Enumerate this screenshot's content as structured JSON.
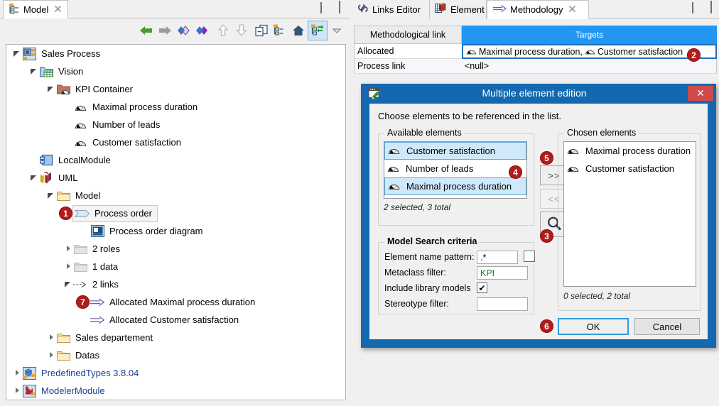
{
  "left_panel": {
    "tab": {
      "label": "Model",
      "close": "✕",
      "icon": "model-tree-icon"
    },
    "window_controls": {
      "minimize": "minimize-icon",
      "maximize": "maximize-icon"
    },
    "toolbar": {
      "items": [
        {
          "name": "back-arrow-icon",
          "title": "Back"
        },
        {
          "name": "forward-arrow-icon",
          "title": "Forward"
        },
        {
          "name": "previous-element-icon",
          "title": "Previous"
        },
        {
          "name": "next-element-icon",
          "title": "Next"
        },
        {
          "name": "up-arrow-icon",
          "title": "Up"
        },
        {
          "name": "down-arrow-icon",
          "title": "Down"
        },
        {
          "name": "collapse-all-icon",
          "title": "Collapse all"
        },
        {
          "name": "expand-tree-icon",
          "title": "Expand"
        },
        {
          "name": "home-icon",
          "title": "Home"
        },
        {
          "name": "link-with-editor-icon",
          "title": "Link with editor"
        },
        {
          "name": "view-menu-icon",
          "title": "View menu"
        }
      ]
    },
    "tree": [
      {
        "label": "Sales Process",
        "indent": 0,
        "twist": "open",
        "icon": "model-project-icon",
        "selected": false
      },
      {
        "label": "Vision",
        "indent": 1,
        "twist": "open",
        "icon": "vision-folder-icon",
        "selected": false
      },
      {
        "label": "KPI Container",
        "indent": 2,
        "twist": "open",
        "icon": "kpi-container-icon",
        "selected": false
      },
      {
        "label": "Maximal process duration",
        "indent": 3,
        "twist": "none",
        "icon": "kpi-gauge-icon",
        "selected": false
      },
      {
        "label": "Number of leads",
        "indent": 3,
        "twist": "none",
        "icon": "kpi-gauge-icon",
        "selected": false
      },
      {
        "label": "Customer satisfaction",
        "indent": 3,
        "twist": "none",
        "icon": "kpi-gauge-icon",
        "selected": false
      },
      {
        "label": "LocalModule",
        "indent": 1,
        "twist": "none",
        "icon": "local-module-icon",
        "selected": false
      },
      {
        "label": "UML",
        "indent": 1,
        "twist": "open",
        "icon": "uml-icon",
        "selected": false
      },
      {
        "label": "Model",
        "indent": 2,
        "twist": "open",
        "icon": "folder-icon",
        "selected": false
      },
      {
        "label": "Process order",
        "indent": 3,
        "twist": "none",
        "icon": "process-icon",
        "selected": true,
        "badge": "1"
      },
      {
        "label": "Process order diagram",
        "indent": 4,
        "twist": "none",
        "icon": "diagram-icon",
        "selected": false
      },
      {
        "label": "2 roles",
        "indent": 3,
        "twist": "closed",
        "icon": "roles-folder-icon",
        "selected": false
      },
      {
        "label": "1 data",
        "indent": 3,
        "twist": "closed",
        "icon": "data-folder-icon",
        "selected": false
      },
      {
        "label": "2 links",
        "indent": 3,
        "twist": "open",
        "icon": "links-arrow-icon",
        "selected": false
      },
      {
        "label": "Allocated Maximal process duration",
        "indent": 4,
        "twist": "none",
        "icon": "allocation-arrow-icon",
        "selected": false,
        "badge": "7"
      },
      {
        "label": "Allocated Customer satisfaction",
        "indent": 4,
        "twist": "none",
        "icon": "allocation-arrow-icon",
        "selected": false
      },
      {
        "label": "Sales departement",
        "indent": 2,
        "twist": "closed",
        "icon": "folder-icon",
        "selected": false
      },
      {
        "label": "Datas",
        "indent": 2,
        "twist": "closed",
        "icon": "folder-icon",
        "selected": false
      },
      {
        "label": "PredefinedTypes 3.8.04",
        "indent": 0,
        "twist": "closed",
        "icon": "predefined-types-icon",
        "selected": false,
        "link": true
      },
      {
        "label": "ModelerModule",
        "indent": 0,
        "twist": "closed",
        "icon": "modeler-module-icon",
        "selected": false,
        "link": true
      }
    ]
  },
  "right_panel": {
    "tabs": [
      {
        "label": "Links Editor",
        "icon": "links-editor-icon",
        "active": false,
        "closable": false
      },
      {
        "label": "Element",
        "icon": "element-table-icon",
        "active": false,
        "closable": false
      },
      {
        "label": "Methodology",
        "icon": "methodology-arrow-icon",
        "active": true,
        "closable": true,
        "close": "✕"
      }
    ],
    "window_controls": {
      "minimize": "minimize-icon",
      "maximize": "maximize-icon"
    },
    "table": {
      "headers": [
        "Methodological link",
        "Targets"
      ],
      "header_accent": "#2196f3",
      "rows": [
        {
          "link": "Allocated",
          "targets": "Maximal process duration,  Customer satisfaction",
          "focused": true,
          "badge": "2",
          "target_items": [
            "Maximal process duration,",
            "Customer satisfaction"
          ]
        },
        {
          "link": "Process link",
          "targets": "<null>",
          "focused": false,
          "target_items": []
        }
      ]
    }
  },
  "dialog": {
    "title": "Multiple element edition",
    "title_icon": "edit-element-icon",
    "close_label": "✕",
    "instruction": "Choose elements to be referenced in the list.",
    "available": {
      "group_title": "Available elements",
      "items": [
        {
          "label": "Customer satisfaction",
          "selected": true
        },
        {
          "label": "Number of leads",
          "selected": false
        },
        {
          "label": "Maximal process duration",
          "selected": true
        }
      ],
      "count": "2 selected, 3 total",
      "badge": "4"
    },
    "transfer": {
      "add_label": ">>",
      "remove_label": "<<",
      "search_icon": "search-magnifier-icon",
      "add_badge": "5",
      "search_badge": "3"
    },
    "chosen": {
      "group_title": "Chosen elements",
      "items": [
        {
          "label": "Maximal process duration"
        },
        {
          "label": "Customer satisfaction"
        }
      ],
      "count": "0 selected, 2 total"
    },
    "criteria": {
      "group_title": "Model Search criteria",
      "name_pattern_label": "Element name pattern:",
      "name_pattern_value": ".*",
      "name_pattern_checkbox": false,
      "metaclass_label": "Metaclass filter:",
      "metaclass_value": "KPI",
      "include_library_label": "Include library models",
      "include_library_checked": true,
      "stereotype_label": "Stereotype filter:",
      "stereotype_value": ""
    },
    "buttons": {
      "ok": "OK",
      "cancel": "Cancel",
      "ok_badge": "6"
    }
  }
}
